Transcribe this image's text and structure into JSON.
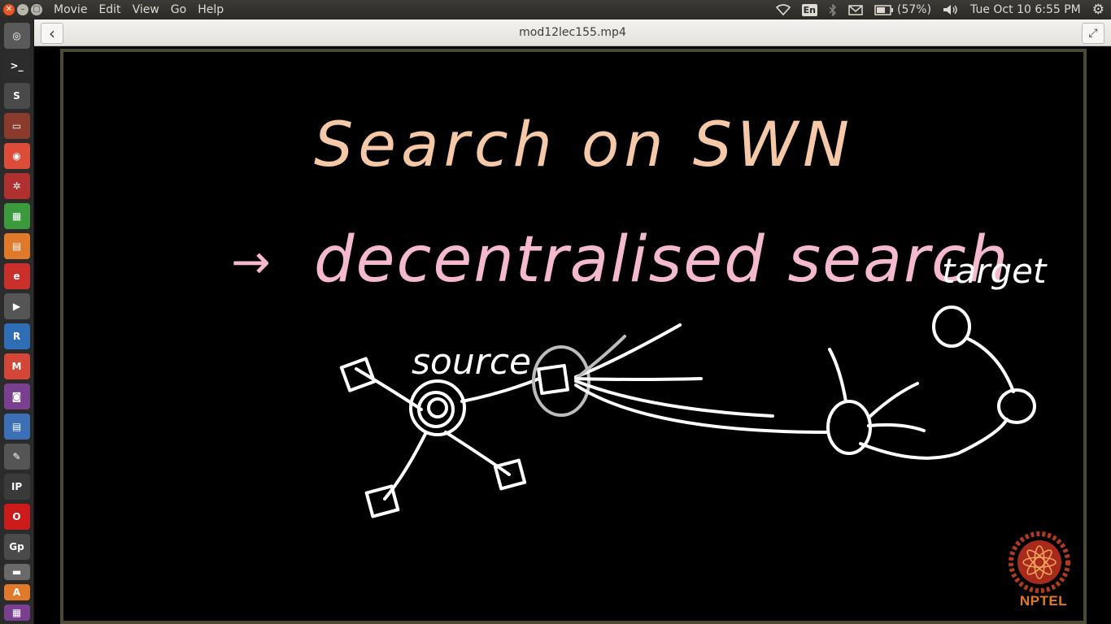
{
  "top_panel": {
    "menu": [
      "Movie",
      "Edit",
      "View",
      "Go",
      "Help"
    ],
    "keyboard_layout": "En",
    "battery_text": "(57%)",
    "datetime": "Tue Oct 10  6:55 PM",
    "icons": [
      "wifi-icon",
      "bluetooth-icon",
      "mail-icon",
      "battery-icon",
      "volume-icon",
      "settings-gear-icon"
    ]
  },
  "window": {
    "title": "mod12lec155.mp4",
    "back_symbol": "‹",
    "fullscreen_symbol": "⤢"
  },
  "launcher": {
    "items": [
      {
        "icon": "dash-icon",
        "color": "#5a5a5a",
        "glyph": "◎"
      },
      {
        "icon": "terminal-icon",
        "color": "#2c2c2c",
        "glyph": ">_"
      },
      {
        "icon": "sublime-text-icon",
        "color": "#4a4a4a",
        "glyph": "S"
      },
      {
        "icon": "file-manager-icon",
        "color": "#8b3a2e",
        "glyph": "▭"
      },
      {
        "icon": "chrome-icon",
        "color": "#dd4b39",
        "glyph": "◉"
      },
      {
        "icon": "settings-icon",
        "color": "#b03030",
        "glyph": "✲"
      },
      {
        "icon": "spreadsheet-icon",
        "color": "#3c9a3c",
        "glyph": "▦"
      },
      {
        "icon": "presentation-icon",
        "color": "#e07a2a",
        "glyph": "▤"
      },
      {
        "icon": "pdf-reader-icon",
        "color": "#c9302c",
        "glyph": "e"
      },
      {
        "icon": "video-editor-icon",
        "color": "#555555",
        "glyph": "▶"
      },
      {
        "icon": "r-icon",
        "color": "#2f6db5",
        "glyph": "R"
      },
      {
        "icon": "gmail-icon",
        "color": "#d44638",
        "glyph": "M"
      },
      {
        "icon": "media-icon",
        "color": "#7a3f8f",
        "glyph": "◙"
      },
      {
        "icon": "writer-icon",
        "color": "#3b6fb6",
        "glyph": "▤"
      },
      {
        "icon": "text-editor-icon",
        "color": "#555555",
        "glyph": "✎"
      },
      {
        "icon": "ipython-icon",
        "color": "#3a3a3a",
        "glyph": "IP"
      },
      {
        "icon": "opera-icon",
        "color": "#cc1b1b",
        "glyph": "O"
      },
      {
        "icon": "gp-icon",
        "color": "#4a4a4a",
        "glyph": "Gp"
      },
      {
        "icon": "drive-icon",
        "color": "#6a6a6a",
        "glyph": "▬"
      },
      {
        "icon": "software-center-icon",
        "color": "#e07a2a",
        "glyph": "A"
      },
      {
        "icon": "workspace-icon",
        "color": "#7a3f8f",
        "glyph": "▦"
      }
    ]
  },
  "board": {
    "title": "Search on SWN",
    "arrow": "→",
    "subtitle": "decentralised search",
    "label_source": "source",
    "label_target": "target",
    "title_color": "#f5c8a8",
    "subtitle_color": "#f4b8cf",
    "ink_color": "#ffffff",
    "dim_ink_color": "#bdbdbd"
  },
  "logo": {
    "text": "NPTEL",
    "color": "#e27a1f"
  }
}
